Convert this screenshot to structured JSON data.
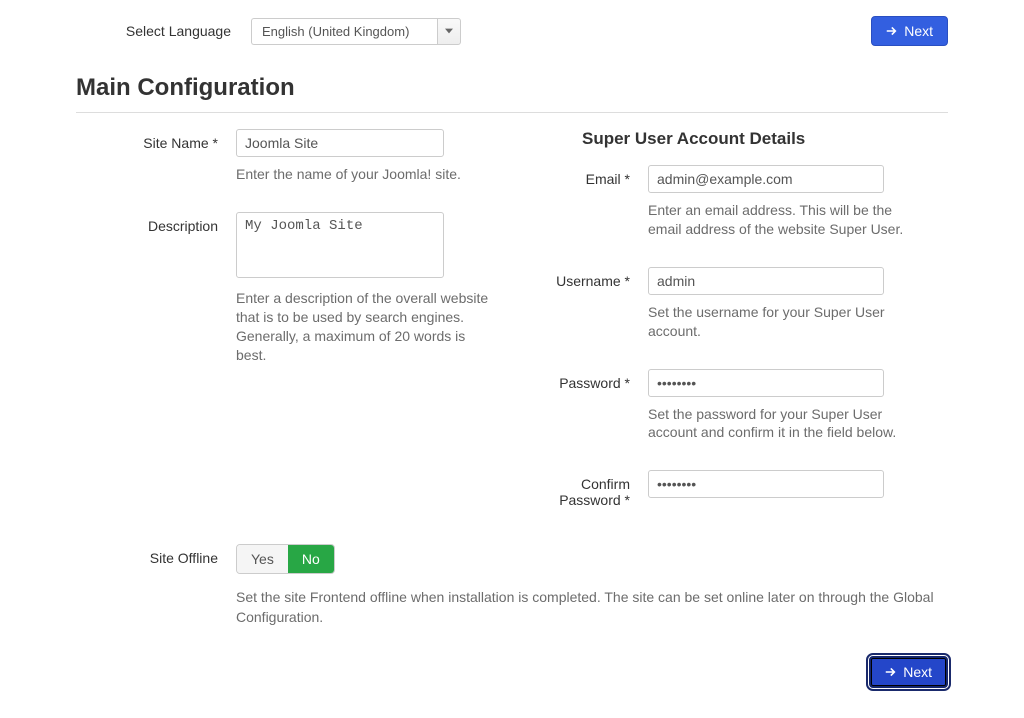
{
  "language": {
    "label": "Select Language",
    "selected": "English (United Kingdom)"
  },
  "buttons": {
    "next": "Next"
  },
  "page_title": "Main Configuration",
  "left": {
    "site_name": {
      "label": "Site Name *",
      "value": "Joomla Site",
      "help": "Enter the name of your Joomla! site."
    },
    "description": {
      "label": "Description",
      "value": "My Joomla Site",
      "help": "Enter a description of the overall website that is to be used by search engines. Generally, a maximum of 20 words is best."
    }
  },
  "right": {
    "heading": "Super User Account Details",
    "email": {
      "label": "Email *",
      "value": "admin@example.com",
      "help": "Enter an email address. This will be the email address of the website Super User."
    },
    "username": {
      "label": "Username *",
      "value": "admin",
      "help": "Set the username for your Super User account."
    },
    "password": {
      "label": "Password *",
      "value": "••••••••",
      "help": "Set the password for your Super User account and confirm it in the field below."
    },
    "confirm": {
      "label": "Confirm Password *",
      "value": "••••••••"
    }
  },
  "offline": {
    "label": "Site Offline",
    "yes": "Yes",
    "no": "No",
    "help": "Set the site Frontend offline when installation is completed. The site can be set online later on through the Global Configuration."
  }
}
